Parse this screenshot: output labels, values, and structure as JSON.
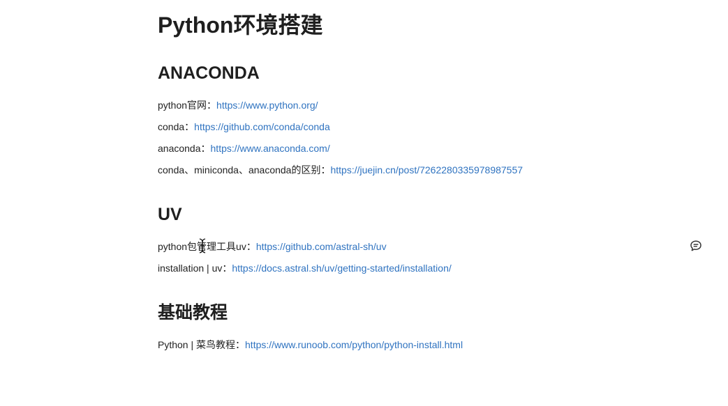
{
  "document": {
    "title": "Python环境搭建"
  },
  "sections": [
    {
      "heading": "ANACONDA",
      "lines": [
        {
          "label": "python官网：",
          "link": "https://www.python.org/"
        },
        {
          "label": "conda：",
          "link": "https://github.com/conda/conda"
        },
        {
          "label": "anaconda：",
          "link": "https://www.anaconda.com/"
        },
        {
          "label": "conda、miniconda、anaconda的区别：",
          "link": "https://juejin.cn/post/7262280335978987557"
        }
      ]
    },
    {
      "heading": "UV",
      "lines": [
        {
          "label": "python包管理工具uv：",
          "link": "https://github.com/astral-sh/uv"
        },
        {
          "label": "installation | uv：",
          "link": "https://docs.astral.sh/uv/getting-started/installation/"
        }
      ]
    },
    {
      "heading": "基础教程",
      "lines": [
        {
          "label": "Python | 菜鸟教程：",
          "link": "https://www.runoob.com/python/python-install.html"
        }
      ]
    }
  ],
  "icons": {
    "comment": "comment-icon",
    "cursor": "text-cursor-icon"
  },
  "colors": {
    "link": "#2f73c0",
    "text": "#222222",
    "heading": "#1f1f1f",
    "background": "#ffffff"
  }
}
